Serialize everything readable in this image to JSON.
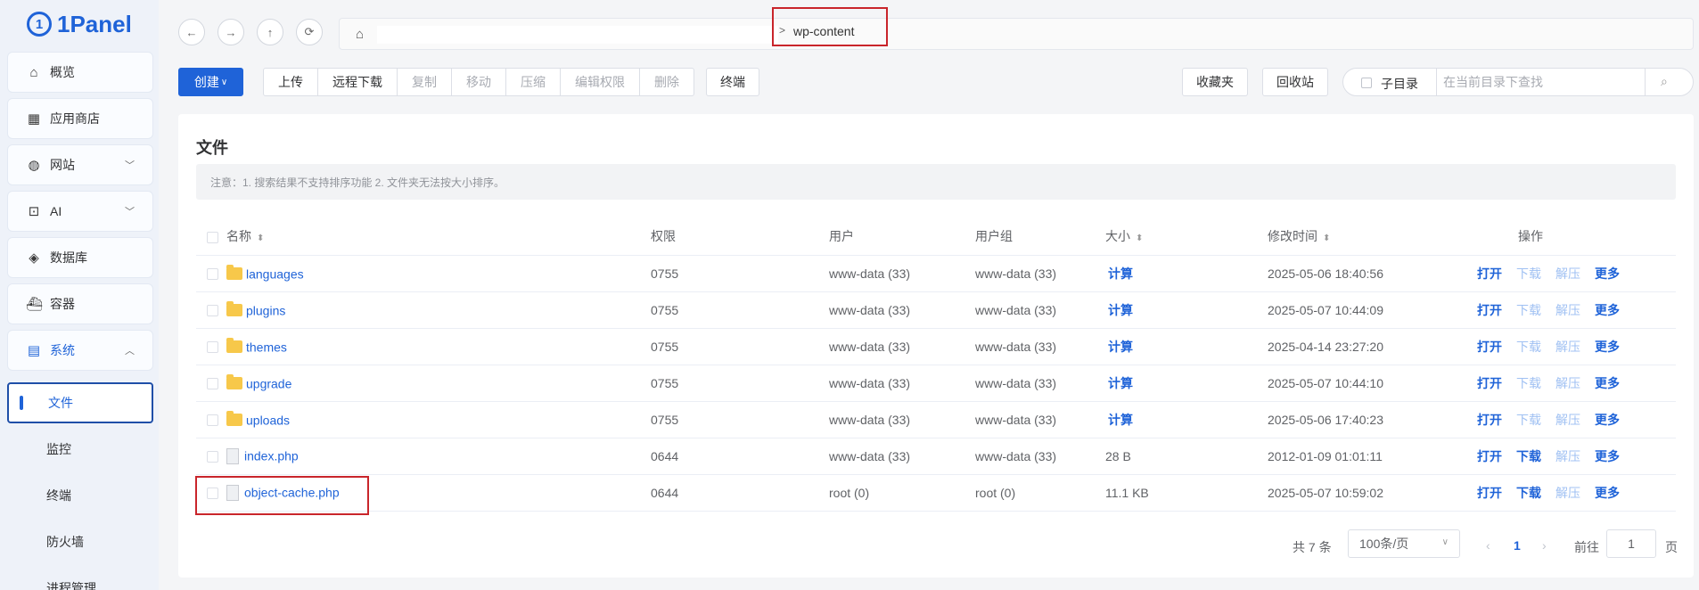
{
  "app": {
    "logo_text": "1Panel",
    "logo_mark": "1"
  },
  "sidebar": {
    "items": [
      {
        "label": "概览",
        "icon": "home-icon",
        "glyph": "⌂"
      },
      {
        "label": "应用商店",
        "icon": "grid-icon",
        "glyph": "▦"
      },
      {
        "label": "网站",
        "icon": "globe-icon",
        "glyph": "◍",
        "chevron": "﹀"
      },
      {
        "label": "AI",
        "icon": "robot-icon",
        "glyph": "⊡",
        "chevron": "﹀"
      },
      {
        "label": "数据库",
        "icon": "layers-icon",
        "glyph": "◈"
      },
      {
        "label": "容器",
        "icon": "container-icon",
        "glyph": "⛴"
      },
      {
        "label": "系统",
        "icon": "system-icon",
        "glyph": "▤",
        "chevron": "︿"
      }
    ],
    "sub_items": [
      {
        "label": "文件",
        "active": true
      },
      {
        "label": "监控"
      },
      {
        "label": "终端"
      },
      {
        "label": "防火墙"
      },
      {
        "label": "进程管理"
      }
    ]
  },
  "nav": {
    "back": "←",
    "forward": "→",
    "up": "↑",
    "refresh": "⟳",
    "home_glyph": "⌂",
    "separator": ">",
    "current_segment": "wp-content"
  },
  "toolbar": {
    "create": "创建",
    "create_caret": "∨",
    "group": [
      {
        "label": "上传",
        "disabled": false
      },
      {
        "label": "远程下载",
        "disabled": false
      },
      {
        "label": "复制",
        "disabled": true
      },
      {
        "label": "移动",
        "disabled": true
      },
      {
        "label": "压缩",
        "disabled": true
      },
      {
        "label": "编辑权限",
        "disabled": true
      },
      {
        "label": "删除",
        "disabled": true
      }
    ],
    "terminal": "终端",
    "favorites": "收藏夹",
    "recycle_bin": "回收站",
    "subdir_label": "子目录",
    "search_placeholder": "在当前目录下查找",
    "search_icon": "⌕"
  },
  "files": {
    "title": "文件",
    "notice": "注意：1. 搜索结果不支持排序功能 2. 文件夹无法按大小排序。",
    "columns": {
      "name": "名称",
      "perm": "权限",
      "user": "用户",
      "group": "用户组",
      "size": "大小",
      "mtime": "修改时间",
      "ops": "操作",
      "sort_glyph": "⬍"
    },
    "rows": [
      {
        "name": "languages",
        "type": "folder",
        "perm": "0755",
        "user": "www-data (33)",
        "group": "www-data (33)",
        "size": "计算",
        "mtime": "2025-05-06 18:40:56"
      },
      {
        "name": "plugins",
        "type": "folder",
        "perm": "0755",
        "user": "www-data (33)",
        "group": "www-data (33)",
        "size": "计算",
        "mtime": "2025-05-07 10:44:09"
      },
      {
        "name": "themes",
        "type": "folder",
        "perm": "0755",
        "user": "www-data (33)",
        "group": "www-data (33)",
        "size": "计算",
        "mtime": "2025-04-14 23:27:20"
      },
      {
        "name": "upgrade",
        "type": "folder",
        "perm": "0755",
        "user": "www-data (33)",
        "group": "www-data (33)",
        "size": "计算",
        "mtime": "2025-05-07 10:44:10"
      },
      {
        "name": "uploads",
        "type": "folder",
        "perm": "0755",
        "user": "www-data (33)",
        "group": "www-data (33)",
        "size": "计算",
        "mtime": "2025-05-06 17:40:23"
      },
      {
        "name": "index.php",
        "type": "file",
        "perm": "0644",
        "user": "www-data (33)",
        "group": "www-data (33)",
        "size": "28 B",
        "mtime": "2012-01-09 01:01:11"
      },
      {
        "name": "object-cache.php",
        "type": "file",
        "perm": "0644",
        "user": "root (0)",
        "group": "root (0)",
        "size": "11.1 KB",
        "mtime": "2025-05-07 10:59:02"
      }
    ],
    "actions": {
      "open": "打开",
      "download": "下载",
      "extract": "解压",
      "more": "更多"
    }
  },
  "pagination": {
    "total": "共 7 条",
    "page_size": "100条/页",
    "page_size_caret": "∨",
    "prev": "‹",
    "current": "1",
    "next": "›",
    "goto_label": "前往",
    "goto_value": "1",
    "page_suffix": "页"
  }
}
